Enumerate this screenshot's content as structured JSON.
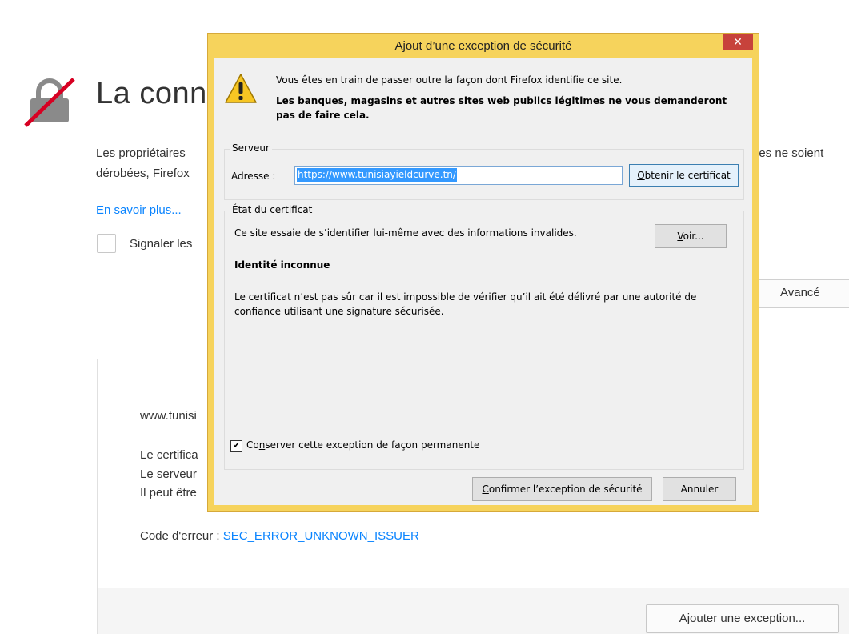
{
  "page": {
    "title": "La conne",
    "intro_line1": "Les propriétaires",
    "intro_line2": "dérobées, Firefox",
    "intro_right": "ées ne soient",
    "learn_more": "En savoir plus...",
    "report_label": "Signaler les",
    "advanced_button": "Avancé",
    "details": {
      "host": "www.tunisi",
      "line1": "Le certifica",
      "line2": "Le serveur",
      "line3": "Il peut être",
      "error_code_label": "Code d'erreur : ",
      "error_code": "SEC_ERROR_UNKNOWN_ISSUER"
    },
    "add_exception_button": "Ajouter une exception..."
  },
  "dialog": {
    "title": "Ajout d’une exception de sécurité",
    "close_glyph": "✕",
    "warning_line1": "Vous êtes en train de passer outre la façon dont Firefox identifie ce site.",
    "warning_line2": "Les banques, magasins et autres sites web publics légitimes ne vous demanderont pas de faire cela.",
    "server_legend": "Serveur",
    "address_label": "Adresse :",
    "address_value": "https://www.tunisiayieldcurve.tn/",
    "get_cert_mnemonic": "O",
    "get_cert_rest": "btenir le certificat",
    "cert_legend": "État du certificat",
    "cert_status": "Ce site essaie de s’identifier lui-même avec des informations invalides.",
    "view_mnemonic": "V",
    "view_rest": "oir...",
    "identity": "Identité inconnue",
    "cert_detail": "Le certificat n’est pas sûr car il est impossible de vérifier qu’il ait été délivré par une autorité de confiance utilisant une signature sécurisée.",
    "permanent_checked": true,
    "permanent_pre": "Co",
    "permanent_mnemonic": "n",
    "permanent_post": "server cette exception de façon permanente",
    "confirm_mnemonic": "C",
    "confirm_rest": "onfirmer l’exception de sécurité",
    "cancel_label": "Annuler"
  },
  "colors": {
    "accent_link": "#0a84ff",
    "dialog_frame": "#f6d35c",
    "close_button": "#c7423b",
    "selection": "#3399ff"
  },
  "icons": {
    "lock": "broken-lock-icon",
    "warning": "warning-triangle-icon"
  }
}
